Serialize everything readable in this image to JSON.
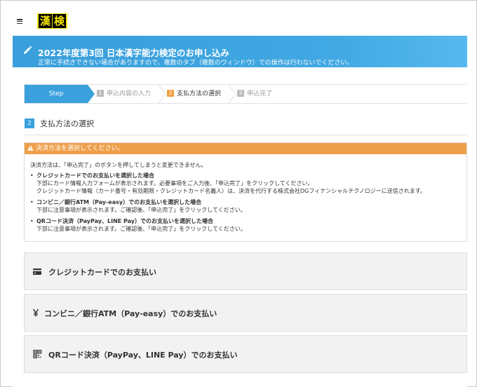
{
  "header": {
    "logo_chars": [
      "漢",
      "検"
    ]
  },
  "banner": {
    "title": "2022年度第3回 日本漢字能力検定のお申し込み",
    "subtitle": "正常に手続きできない場合がありますので、複数のタブ（複数のウィンドウ）での操作は行わないでください。"
  },
  "steps": [
    {
      "label": "Step",
      "state": "active"
    },
    {
      "num": "1",
      "label": "申込内容の入力",
      "state": "done"
    },
    {
      "num": "2",
      "label": "支払方法の選択",
      "state": "current"
    },
    {
      "num": "3",
      "label": "申込完了",
      "state": "pending"
    }
  ],
  "section": {
    "num": "2",
    "title": "支払方法の選択"
  },
  "notice": {
    "header": "決済方法を選択してください。",
    "intro": "決済方法は、「申込完了」のボタンを押してしまうと変更できません。",
    "items": [
      {
        "title": "クレジットカードでのお支払いを選択した場合",
        "lines": [
          "下部にカード情報入力フォームが表示されます。必要事項をご入力後、「申込完了」をクリックしてください。",
          "クレジットカード情報（カード番号・有効期限・クレジットカード名義人）は、決済を代行する株式会社DGフィナンシャルテクノロジーに送信されます。"
        ]
      },
      {
        "title": "コンビニ／銀行ATM（Pay-easy）でのお支払いを選択した場合",
        "lines": [
          "下部に注意事項が表示されます。ご確認後、「申込完了」をクリックしてください。"
        ]
      },
      {
        "title": "QRコード決済（PayPay、LINE Pay）でのお支払いを選択した場合",
        "lines": [
          "下部に注意事項が表示されます。ご確認後、「申込完了」をクリックしてください。"
        ]
      }
    ]
  },
  "payment_options": [
    {
      "icon": "credit-card-icon",
      "label": "クレジットカードでのお支払い"
    },
    {
      "icon": "yen-icon",
      "label": "コンビニ／銀行ATM（Pay-easy）でのお支払い"
    },
    {
      "icon": "qr-code-icon",
      "label": "QRコード決済（PayPay、LINE Pay）でのお支払い"
    }
  ],
  "colors": {
    "accent": "#3aa1dd",
    "warning": "#ee9f4a",
    "current_step": "#f0a040",
    "logo_bg": "#f3e200"
  }
}
